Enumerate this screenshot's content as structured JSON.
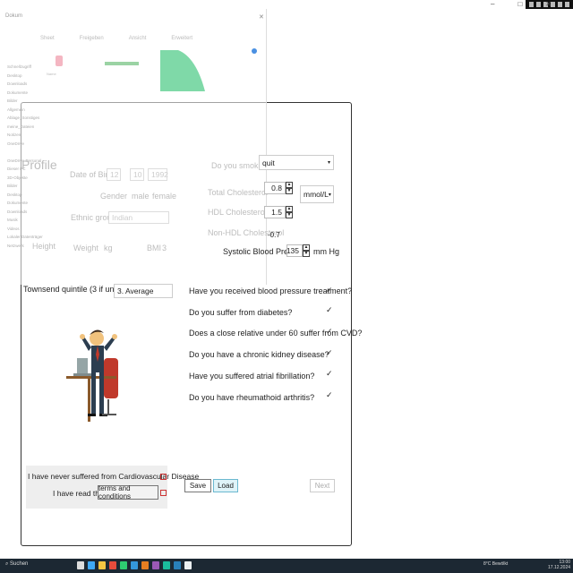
{
  "explorer": {
    "window_title": "Dokum",
    "tabs": [
      "Sheet",
      "Freigeben",
      "Ansicht",
      "Erweitert"
    ],
    "nav_items": [
      "Schnellzugriff",
      "Desktop",
      "Downloads",
      "Dokumente",
      "Bilder",
      "Allgemein",
      "Ablage_Sonstiges",
      "meine_Dateien",
      "Notizen",
      "OneDrive",
      "",
      "OneDrive-Personal",
      "Dieser PC",
      "3D-Objekte",
      "Bilder",
      "Desktop",
      "Dokumente",
      "Downloads",
      "Musik",
      "Videos",
      "Lokaler Datenträger",
      "Netzwerk"
    ],
    "list_items": [
      "Name",
      "",
      "",
      "",
      "",
      "",
      "",
      "",
      "",
      "",
      "",
      "",
      "",
      "",
      "",
      "",
      "",
      "",
      "",
      "",
      "",
      "",
      "",
      "",
      "",
      "",
      "",
      "",
      "",
      "",
      "",
      "",
      ""
    ]
  },
  "form": {
    "profile_title": "Profile",
    "dob_label": "Date of Birth",
    "dob_day": "12",
    "dob_month": "10",
    "dob_year": "1992",
    "gender_label": "Gender",
    "gender_male": "male",
    "gender_female": "female",
    "ethnic_label": "Ethnic group",
    "ethnic_value": "Indian",
    "height_label": "Height",
    "weight_label": "Weight",
    "weight_unit": "kg",
    "bmi_label": "BMI",
    "bmi_value": "3",
    "smoke_label": "Do you smoke?",
    "smoke_value": "quit",
    "chol_label": "Total Cholesterol",
    "chol_value": "0.8",
    "chol_unit": "mmol/L",
    "hdl_label": "HDL Cholesterol",
    "hdl_value": "1.5",
    "nonhdl_label": "Non-HDL Cholesterol",
    "nonhdl_value": "-0.7",
    "bp_label": "Systolic Blood Pressure:",
    "bp_value": "135",
    "bp_unit": "mm Hg",
    "townsend_label": "Townsend quintile (3 if unknown)",
    "townsend_value": "3. Average",
    "questions": [
      "Have you received blood pressure treatment?",
      "Do you suffer from diabetes?",
      "Does a close relative under 60 suffer from CVD?",
      "Do you have a chronic kidney disease?",
      "Have you suffered atrial fibrillation?",
      "Do you have rheumathoid arthritis?"
    ],
    "check_mark": "✓",
    "never_cvd": "I have never suffered from Cardiovascular Disease",
    "read_the": "I have read the",
    "terms_button": "terms and conditions",
    "save": "Save",
    "load": "Load",
    "next": "Next"
  },
  "taskbar": {
    "search": "Suchen",
    "tray": "8°C Bewölkt",
    "time": "13:00",
    "date": "17.12.2024"
  },
  "colors": {
    "accent_green": "#7fd9a8",
    "load_bg": "#dff3f8",
    "red": "#cc3333"
  }
}
